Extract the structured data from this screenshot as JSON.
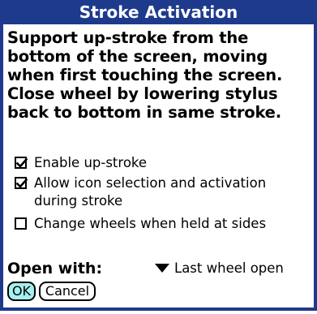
{
  "dialog": {
    "title": "Stroke Activation",
    "description": "Support up-stroke from the bottom of the screen, moving when first touching the screen.  Close wheel by lowering stylus back to bottom in same stroke.",
    "options": [
      {
        "label": "Enable up-stroke",
        "checked": true
      },
      {
        "label": "Allow icon selection and activation during stroke",
        "checked": true
      },
      {
        "label": "Change wheels when held at sides",
        "checked": false
      }
    ],
    "open_with": {
      "label": "Open with:",
      "selected": "Last wheel open"
    },
    "buttons": {
      "ok": "OK",
      "cancel": "Cancel"
    }
  },
  "colors": {
    "frame": "#1e3a8c",
    "title_text": "#ffffff",
    "ok_button_fill": "#a6f0ef"
  },
  "icons": {
    "checkbox_checked": "checkmark-icon",
    "popup_trigger": "triangle-down-icon"
  }
}
